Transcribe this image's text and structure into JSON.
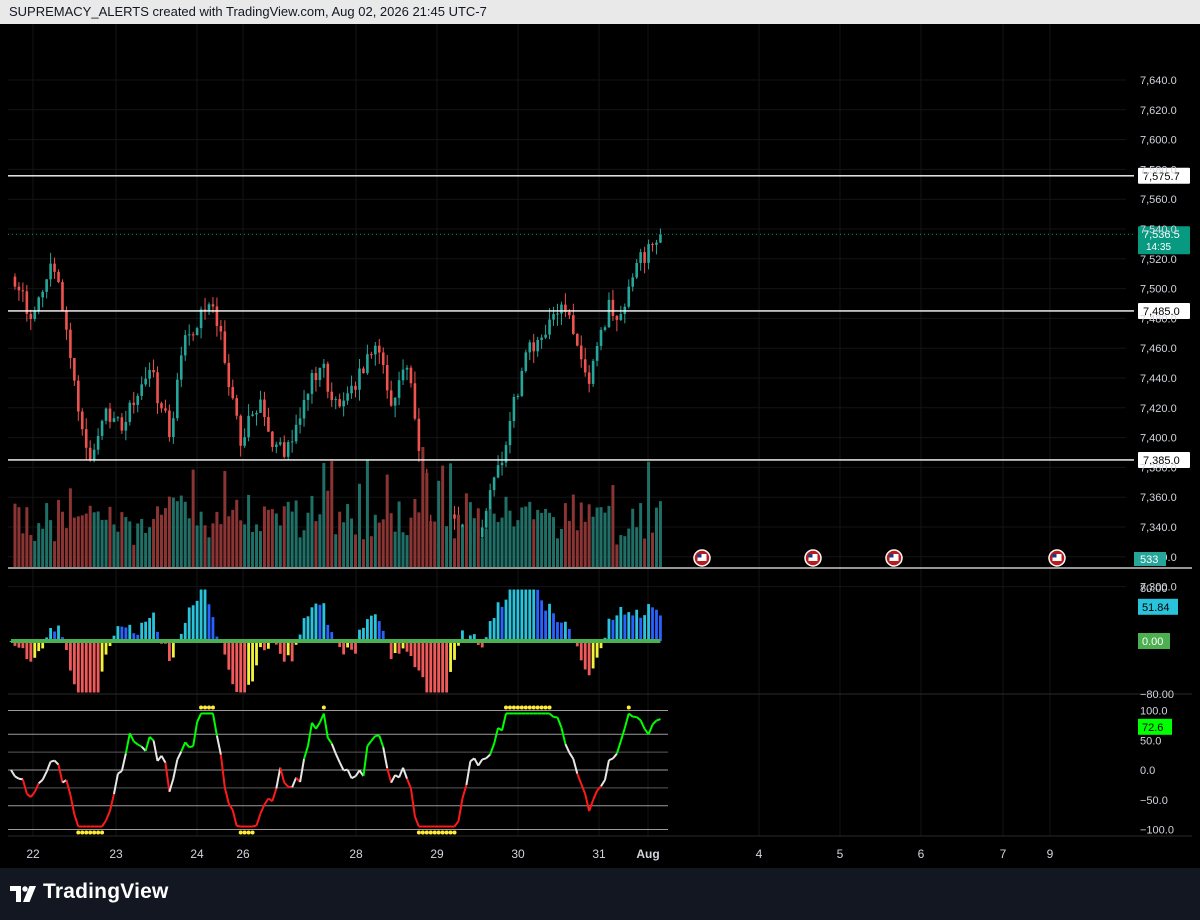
{
  "header": {
    "caption": "SUPREMACY_ALERTS created with TradingView.com, Aug 02, 2026 21:45 UTC-7"
  },
  "footer": {
    "brand": "TradingView"
  },
  "colors": {
    "background": "#000000",
    "up_candle": "#26a69a",
    "down_candle": "#ef5350",
    "volume_up": "#1f6f67",
    "volume_down": "#8a3433",
    "price_badge": "#089981",
    "level_line": "#ffffff",
    "hist_cyan": "#29c4dc",
    "hist_blue": "#2962ff",
    "hist_red": "#f05a5a",
    "hist_yellow": "#f3f33b",
    "signal_green": "#4caf50",
    "osc_green": "#00ff00",
    "osc_red": "#ff1a1a",
    "osc_white": "#e6e6e6",
    "dot_yellow": "#ffeb3b",
    "event_flag": "#b71c1c"
  },
  "chart_data": [
    {
      "type": "candlestick",
      "ylim": [
        7295,
        7655
      ],
      "y_ticks": [
        "7,640.0",
        "7,620.0",
        "7,600.0",
        "7,580.0",
        "7,560.0",
        "7,540.0",
        "7,520.0",
        "7,500.0",
        "7,480.0",
        "7,460.0",
        "7,440.0",
        "7,420.0",
        "7,400.0",
        "7,380.0",
        "7,360.0",
        "7,340.0",
        "7,320.0",
        "7,300.0"
      ],
      "x_ticks": [
        "22",
        "23",
        "24",
        "26",
        "28",
        "29",
        "30",
        "31",
        "Aug",
        "4",
        "5",
        "6",
        "7",
        "9"
      ],
      "horizontal_levels": [
        "7,575.7",
        "7,485.0",
        "7,385.0"
      ],
      "last_price": {
        "label": "7,536.5",
        "countdown": "14:35"
      },
      "close_path": [
        [
          "22",
          7510
        ],
        [
          "22",
          7495
        ],
        [
          "22",
          7480
        ],
        [
          "22",
          7500
        ],
        [
          "22",
          7520
        ],
        [
          "23",
          7495
        ],
        [
          "23",
          7450
        ],
        [
          "23",
          7400
        ],
        [
          "23",
          7390
        ],
        [
          "23",
          7410
        ],
        [
          "23",
          7415
        ],
        [
          "24",
          7405
        ],
        [
          "24",
          7420
        ],
        [
          "24",
          7430
        ],
        [
          "24",
          7450
        ],
        [
          "24",
          7420
        ],
        [
          "24",
          7405
        ],
        [
          "26",
          7460
        ],
        [
          "26",
          7470
        ],
        [
          "26",
          7480
        ],
        [
          "26",
          7490
        ],
        [
          "26",
          7470
        ],
        [
          "26",
          7430
        ],
        [
          "26",
          7400
        ],
        [
          "26",
          7410
        ],
        [
          "26",
          7420
        ],
        [
          "26",
          7400
        ],
        [
          "26",
          7390
        ],
        [
          "28",
          7395
        ],
        [
          "28",
          7420
        ],
        [
          "28",
          7440
        ],
        [
          "28",
          7450
        ],
        [
          "28",
          7430
        ],
        [
          "28",
          7420
        ],
        [
          "28",
          7430
        ],
        [
          "28",
          7445
        ],
        [
          "28",
          7460
        ],
        [
          "28",
          7450
        ],
        [
          "28",
          7420
        ],
        [
          "29",
          7440
        ],
        [
          "29",
          7440
        ],
        [
          "29",
          7380
        ],
        [
          "29",
          7330
        ],
        [
          "29",
          7320
        ],
        [
          "29",
          7345
        ],
        [
          "29",
          7340
        ],
        [
          "29",
          7330
        ],
        [
          "29",
          7340
        ],
        [
          "30",
          7360
        ],
        [
          "30",
          7380
        ],
        [
          "30",
          7420
        ],
        [
          "30",
          7440
        ],
        [
          "30",
          7460
        ],
        [
          "30",
          7470
        ],
        [
          "30",
          7480
        ],
        [
          "30",
          7485
        ],
        [
          "31",
          7480
        ],
        [
          "31",
          7460
        ],
        [
          "31",
          7440
        ],
        [
          "31",
          7470
        ],
        [
          "31",
          7490
        ],
        [
          "31",
          7480
        ],
        [
          "31",
          7510
        ],
        [
          "Aug",
          7520
        ],
        [
          "Aug",
          7530
        ],
        [
          "Aug",
          7536.5
        ]
      ],
      "volume": {
        "current_label": "533"
      },
      "event_markers": [
        "Aug",
        "4",
        "5",
        "7"
      ]
    },
    {
      "type": "histogram",
      "ylim": [
        -80,
        80
      ],
      "y_ticks": [
        "80.00",
        "−80.00"
      ],
      "last_value": "51.84",
      "signal_value": "0.00"
    },
    {
      "type": "line",
      "ylim": [
        -100,
        100
      ],
      "y_ticks": [
        "100.0",
        "50.0",
        "0.0",
        "−50.0",
        "−100.0"
      ],
      "last_value": "72.6"
    }
  ]
}
